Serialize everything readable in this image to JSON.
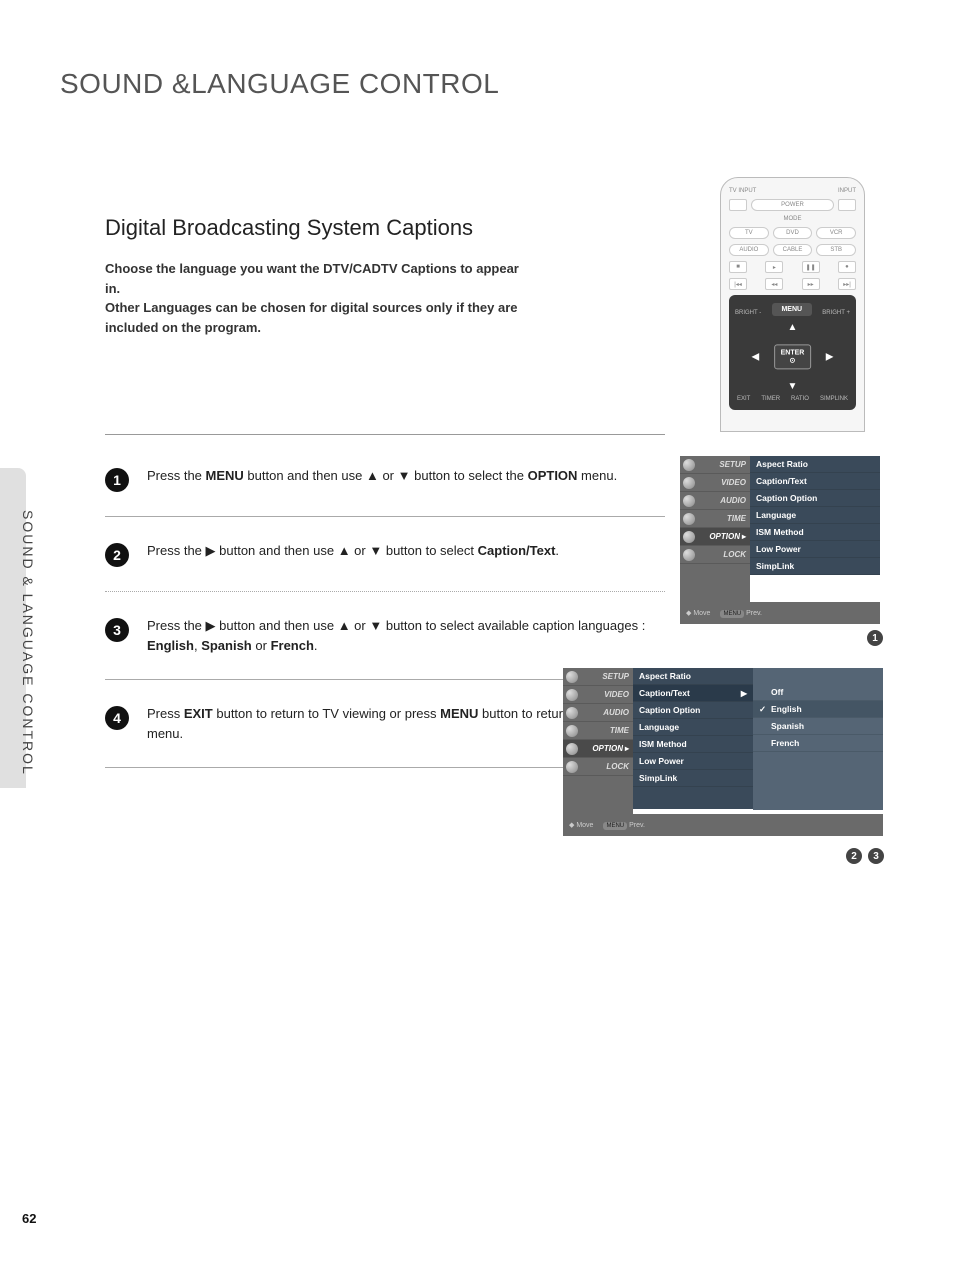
{
  "page": {
    "title": "SOUND &LANGUAGE CONTROL",
    "section_title": "Digital Broadcasting System Captions",
    "intro_line1": "Choose the language you want the DTV/CADTV Captions to appear in.",
    "intro_line2": "Other Languages can be chosen for digital sources only if they are included on the program.",
    "sidebar_label": "SOUND & LANGUAGE CONTROL",
    "page_number": "62"
  },
  "steps": [
    {
      "num": "1",
      "pre": "Press the ",
      "b1": "MENU",
      "mid1": " button and then use ",
      "up": "▲",
      "mid2": " or ",
      "down": "▼",
      "mid3": " button to select the ",
      "b2": "OPTION",
      "post": " menu."
    },
    {
      "num": "2",
      "pre": "Press the ",
      "right": "▶",
      "mid1": " button and then use ",
      "up": "▲",
      "mid2": " or ",
      "down": "▼",
      "mid3": " button to select ",
      "b1": "Caption/Text",
      "post": "."
    },
    {
      "num": "3",
      "pre": "Press the ",
      "right": "▶",
      "mid1": " button and then use ",
      "up": "▲",
      "mid2": " or ",
      "down": "▼",
      "mid3": " button to select available caption languages : ",
      "b1": "English",
      "sep1": ", ",
      "b2": "Spanish",
      "sep2": " or ",
      "b3": "French",
      "post": "."
    },
    {
      "num": "4",
      "pre": "Press ",
      "b1": "EXIT",
      "mid1": " button to return to TV viewing or press ",
      "b2": "MENU",
      "post": " button to return to the previous menu."
    }
  ],
  "remote": {
    "tv_input": "TV INPUT",
    "input": "INPUT",
    "power": "POWER",
    "mode": "MODE",
    "tv": "TV",
    "dvd": "DVD",
    "vcr": "VCR",
    "audio": "AUDIO",
    "cable": "CABLE",
    "stb": "STB",
    "menu": "MENU",
    "enter": "ENTER",
    "enter_sym": "⊙",
    "exit": "EXIT",
    "timer": "TIMER",
    "ratio": "RATIO",
    "bright_minus": "BRIGHT -",
    "bright_plus": "BRIGHT +",
    "simplink": "SIMPLINK"
  },
  "osd_categories": [
    "SETUP",
    "VIDEO",
    "AUDIO",
    "TIME",
    "OPTION",
    "LOCK"
  ],
  "osd_items": [
    "Aspect Ratio",
    "Caption/Text",
    "Caption Option",
    "Language",
    "ISM Method",
    "Low Power",
    "SimpLink"
  ],
  "osd_footer": {
    "move": "Move",
    "prev": "Prev."
  },
  "osd2_sub": [
    "Off",
    "English",
    "Spanish",
    "French"
  ],
  "badges": {
    "b1": "1",
    "b2": "2",
    "b3": "3"
  }
}
